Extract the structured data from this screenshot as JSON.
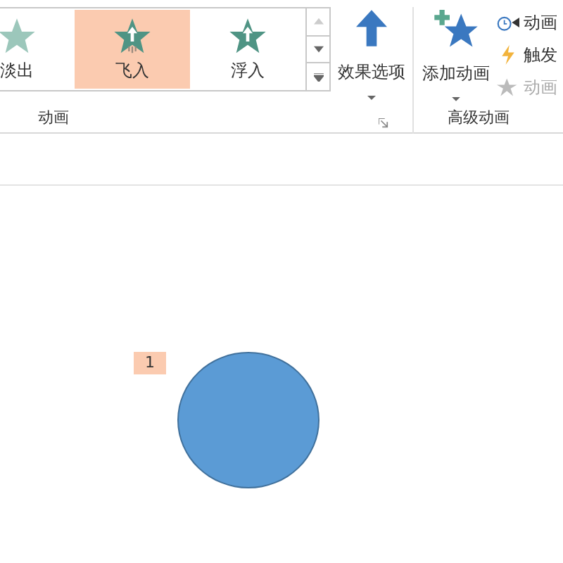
{
  "gallery": {
    "items": [
      {
        "label": "淡出",
        "kind": "fade",
        "selected": false
      },
      {
        "label": "飞入",
        "kind": "fly",
        "selected": true
      },
      {
        "label": "浮入",
        "kind": "float",
        "selected": false
      }
    ]
  },
  "effect_options": {
    "label": "效果选项"
  },
  "group_animation": {
    "label": "动画"
  },
  "add_animation": {
    "label": "添加动画"
  },
  "advanced_commands": [
    {
      "label": "动画",
      "kind": "pane",
      "disabled": false
    },
    {
      "label": "触发",
      "kind": "trigger",
      "disabled": false
    },
    {
      "label": "动画",
      "kind": "painter",
      "disabled": true
    }
  ],
  "group_advanced": {
    "label": "高级动画"
  },
  "slide": {
    "badge": "1"
  }
}
